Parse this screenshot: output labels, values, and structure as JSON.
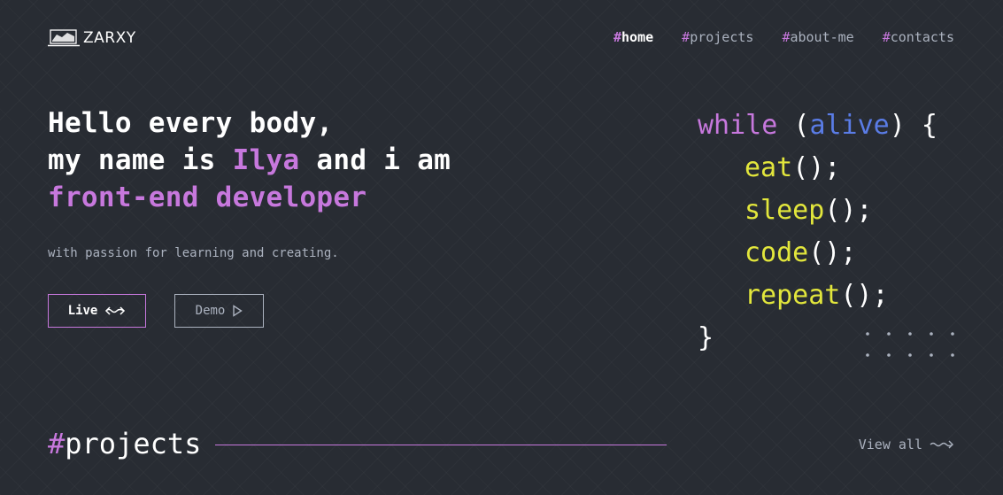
{
  "header": {
    "logo_text": "ZARXY",
    "nav": [
      {
        "hash": "#",
        "label": "home",
        "active": true
      },
      {
        "hash": "#",
        "label": "projects",
        "active": false
      },
      {
        "hash": "#",
        "label": "about-me",
        "active": false
      },
      {
        "hash": "#",
        "label": "contacts",
        "active": false
      }
    ]
  },
  "hero": {
    "line1": "Hello every body,",
    "line2_prefix": "my name is ",
    "name": "Ilya",
    "line2_suffix": " and i am",
    "role": "front-end developer",
    "subtitle": "with passion for learning and creating.",
    "live_label": "Live",
    "demo_label": "Demo"
  },
  "code": {
    "kw": "while",
    "open_paren": " (",
    "var": "alive",
    "close_brace_open": ") {",
    "calls": [
      {
        "fn": "eat",
        "rest": "();"
      },
      {
        "fn": "sleep",
        "rest": "();"
      },
      {
        "fn": "code",
        "rest": "();"
      },
      {
        "fn": "repeat",
        "rest": "();"
      }
    ],
    "close": "}"
  },
  "projects": {
    "hash": "#",
    "title": "projects",
    "view_all": "View all"
  },
  "colors": {
    "background": "#282c33",
    "accent": "#c778dd",
    "muted": "#abb2bf",
    "code_var": "#5a7ce6",
    "code_fn": "#e2e63c"
  },
  "icons": {
    "logo": "laptop-logo-icon",
    "live": "double-arrow-icon",
    "demo": "play-triangle-icon",
    "view_all": "squiggle-arrow-icon",
    "decor": "dots-grid-icon"
  }
}
